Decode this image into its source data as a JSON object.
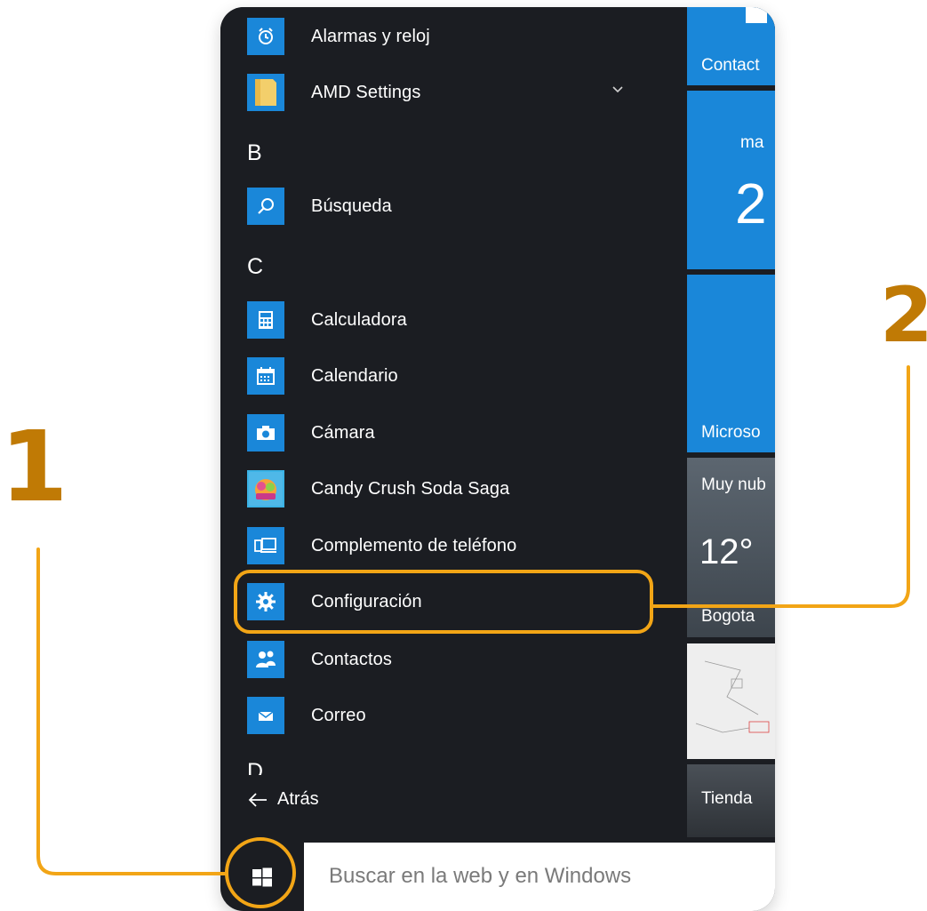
{
  "start_menu": {
    "apps": [
      {
        "label": "Alarmas y reloj",
        "icon": "alarm-clock-icon"
      },
      {
        "label": "AMD Settings",
        "icon": "folder-icon",
        "expandable": true
      },
      {
        "label": "Búsqueda",
        "icon": "search-icon"
      },
      {
        "label": "Calculadora",
        "icon": "calculator-icon"
      },
      {
        "label": "Calendario",
        "icon": "calendar-icon"
      },
      {
        "label": "Cámara",
        "icon": "camera-icon"
      },
      {
        "label": "Candy Crush Soda Saga",
        "icon": "candy-crush-icon"
      },
      {
        "label": "Complemento de teléfono",
        "icon": "phone-companion-icon"
      },
      {
        "label": "Configuración",
        "icon": "gear-icon",
        "highlighted": true
      },
      {
        "label": "Contactos",
        "icon": "people-icon"
      },
      {
        "label": "Correo",
        "icon": "mail-icon"
      }
    ],
    "section_letters": [
      "B",
      "C",
      "D"
    ],
    "back_label": "Atrás"
  },
  "tiles": {
    "contacts_partial": "Contact",
    "calendar_day_partial": "ma",
    "calendar_date_partial": "2",
    "microsoft_partial": "Microso",
    "weather_condition_partial": "Muy nub",
    "weather_temp_partial": "12°",
    "weather_city_partial": "Bogota",
    "store_label": "Tienda"
  },
  "taskbar": {
    "search_placeholder": "Buscar en la web y en Windows"
  },
  "annotations": {
    "step1": "1",
    "step2": "2",
    "accent_color": "#f2a516",
    "number_color": "#c07a05"
  },
  "colors": {
    "menu_bg": "#1b1d22",
    "tile_blue": "#1a87d9"
  }
}
